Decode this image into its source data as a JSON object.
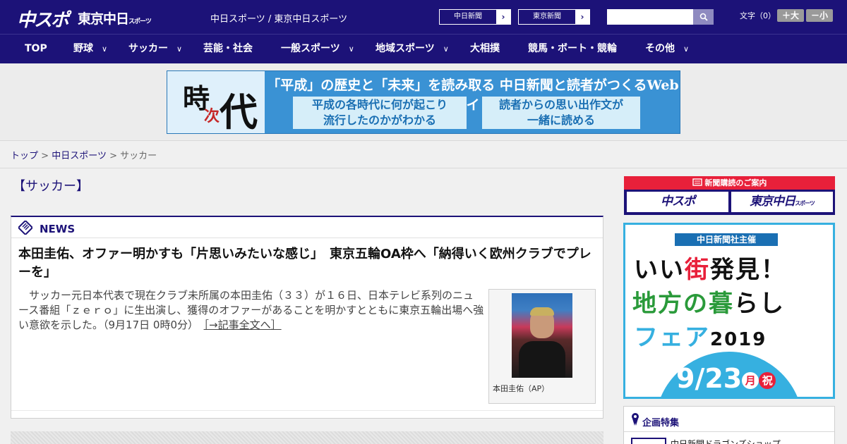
{
  "header": {
    "logo_chuspo": "中スポ",
    "logo_tokyo": "東京中日",
    "logo_tokyo_sub": "スポーツ",
    "title": "中日スポーツ / 東京中日スポーツ",
    "paper_links": [
      {
        "label": "中日新聞",
        "arrow": "›"
      },
      {
        "label": "東京新聞",
        "arrow": "›"
      }
    ],
    "search_placeholder": "",
    "font_size_label": "文字（0）",
    "font_larger": "＋大",
    "font_smaller": "－小"
  },
  "nav": {
    "items": [
      {
        "label": "TOP",
        "chevron": ""
      },
      {
        "label": "野球",
        "chevron": "∨"
      },
      {
        "label": "サッカー",
        "chevron": "∨"
      },
      {
        "label": "芸能・社会",
        "chevron": ""
      },
      {
        "label": "一般スポーツ",
        "chevron": "∨"
      },
      {
        "label": "地域スポーツ",
        "chevron": "∨"
      },
      {
        "label": "大相撲",
        "chevron": ""
      },
      {
        "label": "競馬・ボート・競輪",
        "chevron": ""
      },
      {
        "label": "その他",
        "chevron": "∨"
      }
    ]
  },
  "banner": {
    "ji": "時",
    "tsugi": "次",
    "dai": "代",
    "headline": "「平成」の歴史と「未来」を読み取る 中日新聞と読者がつくるWebサイト",
    "sub_left_1": "平成の各時代に何が起こり",
    "sub_left_2": "流行したのかがわかる",
    "sub_right_1": "読者からの思い出作文が",
    "sub_right_2": "一緒に読める"
  },
  "breadcrumb": {
    "home": "トップ",
    "sep": ">",
    "section": "中日スポーツ",
    "current": "サッカー"
  },
  "main": {
    "section_title": "【サッカー】",
    "news_label": "NEWS",
    "article": {
      "title": "本田圭佑、オファー明かすも「片思いみたいな感じ」　東京五輪OA枠へ「納得いく欧州クラブでプレーを」",
      "body": "　サッカー元日本代表で現在クラブ未所属の本田圭佑（３３）が１６日、日本テレビ系列のニュース番組「ｚｅｒｏ」に生出演し、獲得のオファーがあることを明かすとともに東京五輪出場へ強い意欲を示した。",
      "timestamp": "（9月17日 0時0分）",
      "more": "［→記事全文へ］",
      "photo_caption": "本田圭佑（AP）"
    }
  },
  "sidebar": {
    "subscribe_title": "新聞購読のご案内",
    "subscribe_btn_1": "中スポ",
    "subscribe_btn_2": "東京中日",
    "subscribe_btn_2_sub": "スポーツ",
    "ad": {
      "pill": "中日新聞社主催",
      "line1_a": "いい",
      "line1_b": "街",
      "line1_c": "発見！",
      "line2_a": "地方の",
      "line2_b": "暮",
      "line2_c": "らし",
      "line3_a": "フェア",
      "line3_b": "2019",
      "date_main": "9/23",
      "date_day": "月",
      "date_holiday": "祝"
    },
    "feature": {
      "title": "企画特集",
      "item": "中日新聞ドラゴンズショップ"
    }
  },
  "colors": {
    "brand_navy": "#1c1278",
    "accent_red": "#e8203a",
    "ad_blue": "#36b0e0"
  }
}
